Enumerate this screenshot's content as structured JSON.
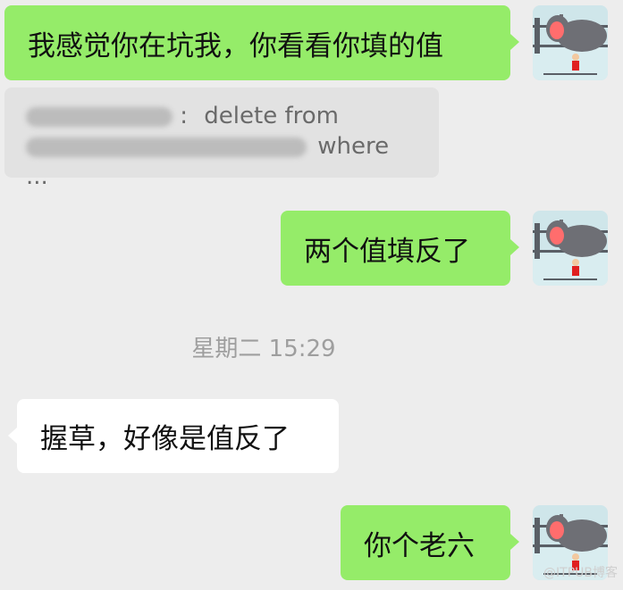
{
  "messages": [
    {
      "side": "right",
      "text": "我感觉你在坑我，你看看你填的值"
    },
    {
      "side": "right",
      "text": "两个值填反了"
    },
    {
      "side": "left",
      "text": "握草，好像是值反了"
    },
    {
      "side": "right",
      "text": "你个老六"
    }
  ],
  "quote": {
    "separator": ":",
    "line1_text": "delete from",
    "line2_text": "where ..."
  },
  "timestamp": "星期二 15:29",
  "watermark": "@ITPUB博客",
  "avatar": {
    "icon": "hippo-zoo-avatar-icon",
    "colors": {
      "sky": "#cfe6ea",
      "water": "#d9edf0",
      "hippo": "#6e6f75",
      "mouth": "#ff6d6d",
      "fence": "#5a5f66",
      "kid": "#e02020"
    }
  },
  "colors": {
    "background": "#ededed",
    "bubble_self": "#95ec69",
    "bubble_other": "#ffffff",
    "quote_bg": "#e2e2e2"
  }
}
